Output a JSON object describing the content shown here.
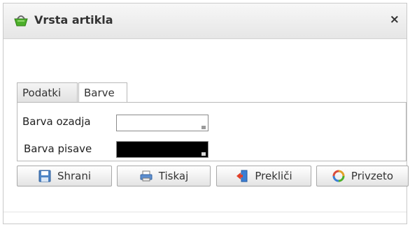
{
  "window": {
    "title": "Vrsta artikla",
    "close_label": "×",
    "title_icon": "basket-icon"
  },
  "tabs": [
    {
      "label": "Podatki",
      "active": false
    },
    {
      "label": "Barve",
      "active": true
    }
  ],
  "fields": {
    "background_color": {
      "label": "Barva ozadja",
      "value": "#ffffff"
    },
    "text_color": {
      "label": "Barva pisave",
      "value": "#000000"
    }
  },
  "buttons": {
    "save": {
      "label": "Shrani",
      "icon": "floppy-disk-icon"
    },
    "print": {
      "label": "Tiskaj",
      "icon": "printer-icon"
    },
    "cancel": {
      "label": "Prekliči",
      "icon": "exit-door-icon"
    },
    "reset": {
      "label": "Privzeto",
      "icon": "refresh-icon"
    }
  }
}
